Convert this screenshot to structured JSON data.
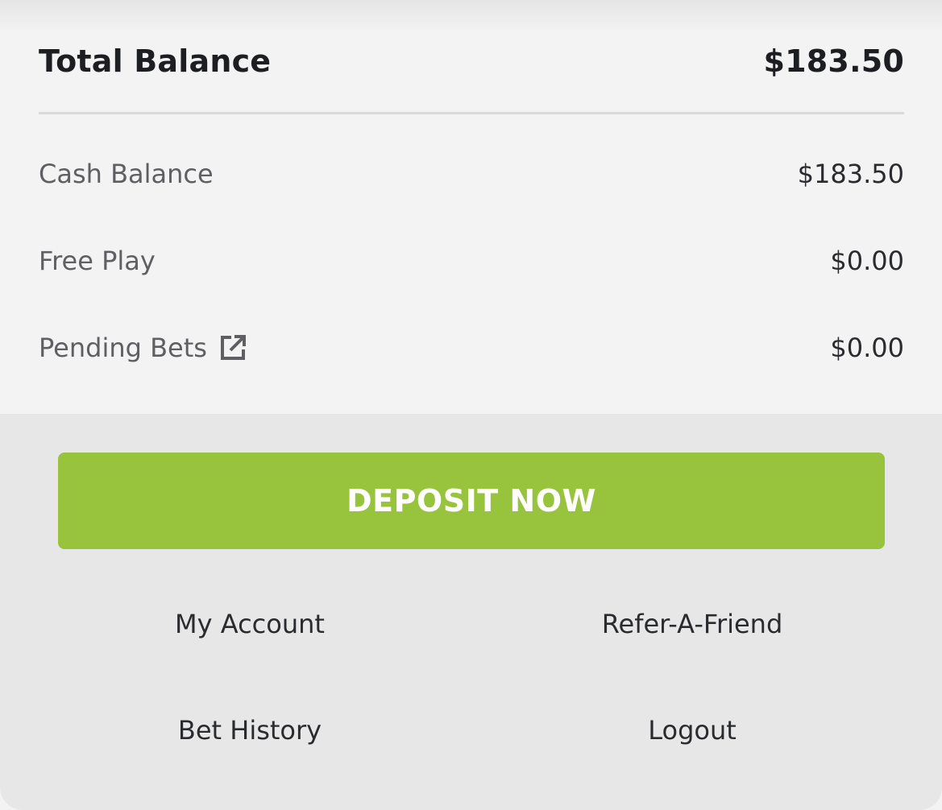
{
  "balances": {
    "total_label": "Total Balance",
    "total_value": "$183.50",
    "rows": [
      {
        "label": "Cash Balance",
        "value": "$183.50"
      },
      {
        "label": "Free Play",
        "value": "$0.00"
      },
      {
        "label": "Pending Bets",
        "value": "$0.00",
        "icon": "external-link-icon"
      }
    ]
  },
  "actions": {
    "deposit_label": "DEPOSIT NOW",
    "links": {
      "my_account": "My Account",
      "refer_a_friend": "Refer-A-Friend",
      "bet_history": "Bet History",
      "logout": "Logout"
    }
  },
  "colors": {
    "deposit_button": "#97c43c",
    "panel_background": "#f4f3f4",
    "actions_background": "#e7e7e7",
    "text_primary": "#1d1e22",
    "text_secondary": "#5f5f63"
  }
}
